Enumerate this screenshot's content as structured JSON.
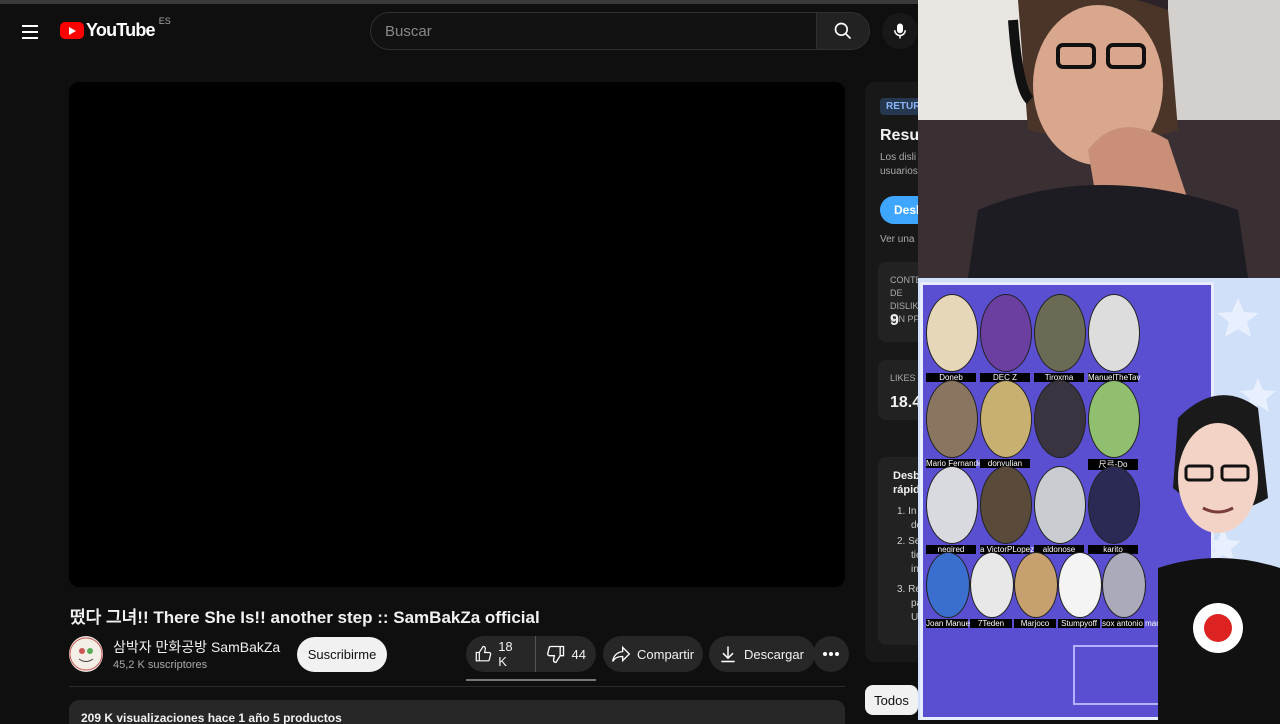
{
  "header": {
    "logo_text": "YouTube",
    "country_code": "ES",
    "search_placeholder": "Buscar",
    "brand_red": "#ff0000"
  },
  "video": {
    "title": "떴다 그녀!! There She Is!! another step :: SamBakZa official",
    "channel_name": "삼박자 만화공방 SamBakZa",
    "subscribers": "45,2 K suscriptores",
    "subscribe_label": "Suscribirme",
    "likes": "18 K",
    "dislikes": "44",
    "share_label": "Compartir",
    "download_label": "Descargar",
    "description_meta": "209 K visualizaciones  hace 1 año  5 productos"
  },
  "side_panel": {
    "badge": "RETUR",
    "title": "Resum",
    "desc_line1": "Los disli",
    "desc_line2": "usuarios",
    "button": "Desb",
    "link": "Ver una",
    "card1_label_l1": "CONTEO DE DISLIKES",
    "card1_label_l2": "SIN PF",
    "card1_value": "9",
    "card2_label": "LIKES",
    "card2_value": "18.4",
    "card3_title_l1": "Desbl",
    "card3_title_l2": "rápido",
    "list": [
      "1.",
      "2.",
      "3."
    ],
    "list_text": [
      "In",
      "de",
      "Se",
      "tie",
      "in",
      "Re",
      "pa",
      "UI"
    ],
    "filter_chip": "Todos"
  },
  "overlay": {
    "names": [
      "Doneb",
      "DEC Z",
      "Tiroxma",
      "ManuelTheTav",
      "Mario Fernandez",
      "donyulian",
      "",
      "尺弓-Do",
      "negired",
      "a VictorPLopez",
      "aldonose",
      "karito",
      "Joan Manuel",
      "7Teden",
      "Marjoco",
      "Stumpyoff",
      "sox antonio marin"
    ],
    "accent": "#5a4fd0"
  }
}
